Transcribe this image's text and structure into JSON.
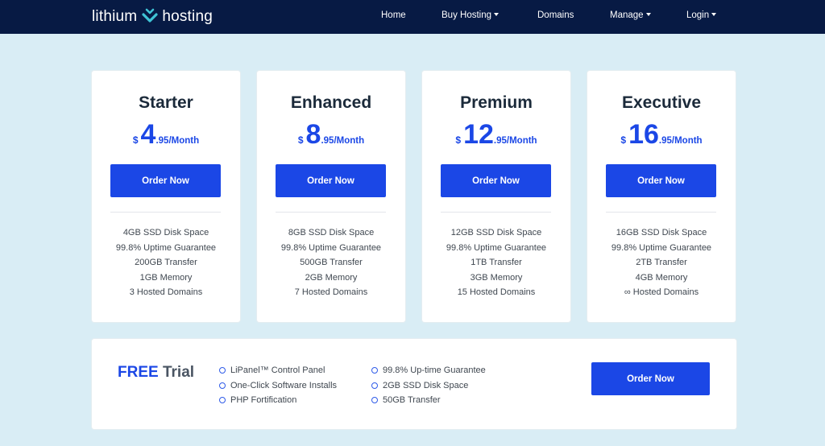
{
  "brand": {
    "left": "lithium",
    "right": "hosting"
  },
  "nav": [
    {
      "label": "Home",
      "dropdown": false
    },
    {
      "label": "Buy Hosting",
      "dropdown": true
    },
    {
      "label": "Domains",
      "dropdown": false
    },
    {
      "label": "Manage",
      "dropdown": true
    },
    {
      "label": "Login",
      "dropdown": true
    }
  ],
  "plans": [
    {
      "name": "Starter",
      "currency": "$",
      "whole": "4",
      "cents": ".95/Month",
      "button": "Order Now",
      "features": [
        "4GB SSD Disk Space",
        "99.8% Uptime Guarantee",
        "200GB Transfer",
        "1GB Memory",
        "3 Hosted Domains"
      ]
    },
    {
      "name": "Enhanced",
      "currency": "$",
      "whole": "8",
      "cents": ".95/Month",
      "button": "Order Now",
      "features": [
        "8GB SSD Disk Space",
        "99.8% Uptime Guarantee",
        "500GB Transfer",
        "2GB Memory",
        "7 Hosted Domains"
      ]
    },
    {
      "name": "Premium",
      "currency": "$",
      "whole": "12",
      "cents": ".95/Month",
      "button": "Order Now",
      "features": [
        "12GB SSD Disk Space",
        "99.8% Uptime Guarantee",
        "1TB Transfer",
        "3GB Memory",
        "15 Hosted Domains"
      ]
    },
    {
      "name": "Executive",
      "currency": "$",
      "whole": "16",
      "cents": ".95/Month",
      "button": "Order Now",
      "features": [
        "16GB SSD Disk Space",
        "99.8% Uptime Guarantee",
        "2TB Transfer",
        "4GB Memory",
        "∞ Hosted Domains"
      ]
    }
  ],
  "trial": {
    "free": "FREE",
    "word": "Trial",
    "col1": [
      "LiPanel™ Control Panel",
      "One-Click Software Installs",
      "PHP Fortification"
    ],
    "col2": [
      "99.8% Up-time Guarantee",
      "2GB SSD Disk Space",
      "50GB Transfer"
    ],
    "button": "Order Now"
  },
  "colors": {
    "navbar": "#071a44",
    "accent": "#1b47e6",
    "background": "#d9edf5"
  }
}
